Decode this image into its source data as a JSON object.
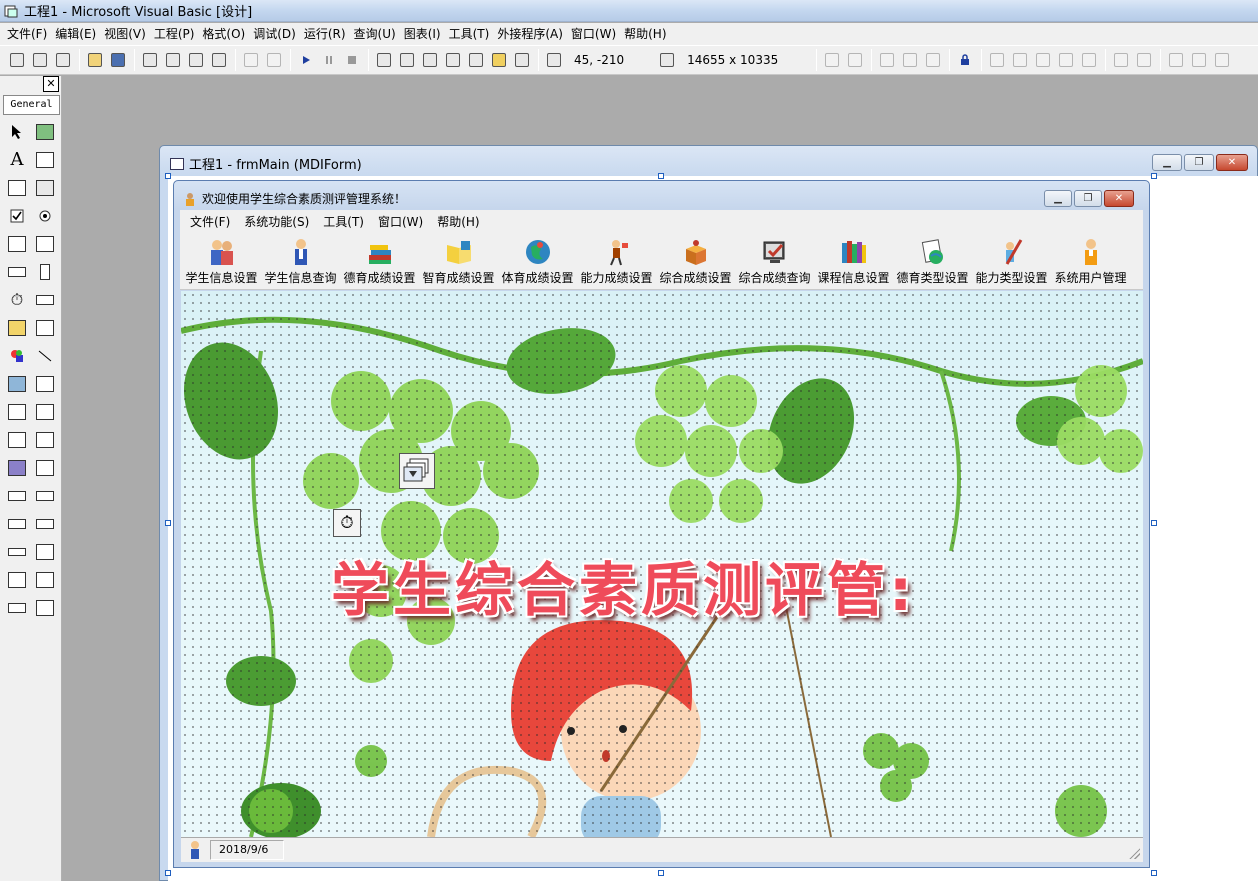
{
  "app": {
    "title": "工程1 - Microsoft Visual Basic [设计]"
  },
  "menu": [
    "文件(F)",
    "编辑(E)",
    "视图(V)",
    "工程(P)",
    "格式(O)",
    "调试(D)",
    "运行(R)",
    "查询(U)",
    "图表(I)",
    "工具(T)",
    "外接程序(A)",
    "窗口(W)",
    "帮助(H)"
  ],
  "toolbar": {
    "position_readout": "45, -210",
    "size_readout": "14655 x 10335"
  },
  "toolbox": {
    "close_glyph": "✕",
    "tab_label": "General",
    "label_tool_glyph": "A"
  },
  "designer": {
    "title": "工程1 - frmMain (MDIForm)"
  },
  "mdi": {
    "title": "欢迎使用学生综合素质测评管理系统！",
    "menu": [
      "文件(F)",
      "系统功能(S)",
      "工具(T)",
      "窗口(W)",
      "帮助(H)"
    ],
    "buttons": [
      "学生信息设置",
      "学生信息查询",
      "德育成绩设置",
      "智育成绩设置",
      "体育成绩设置",
      "能力成绩设置",
      "综合成绩设置",
      "综合成绩查询",
      "课程信息设置",
      "德育类型设置",
      "能力类型设置",
      "系统用户管理"
    ],
    "banner": "学生综合素质测评管:",
    "status_date": "2018/9/6"
  },
  "window_buttons": {
    "minimize": "▁",
    "restore": "❐",
    "close": "✕"
  },
  "colors": {
    "banner_text": "#ef4b5a",
    "title_gradient": "#c4d7ef"
  },
  "icons": {
    "timer": "⏱"
  }
}
